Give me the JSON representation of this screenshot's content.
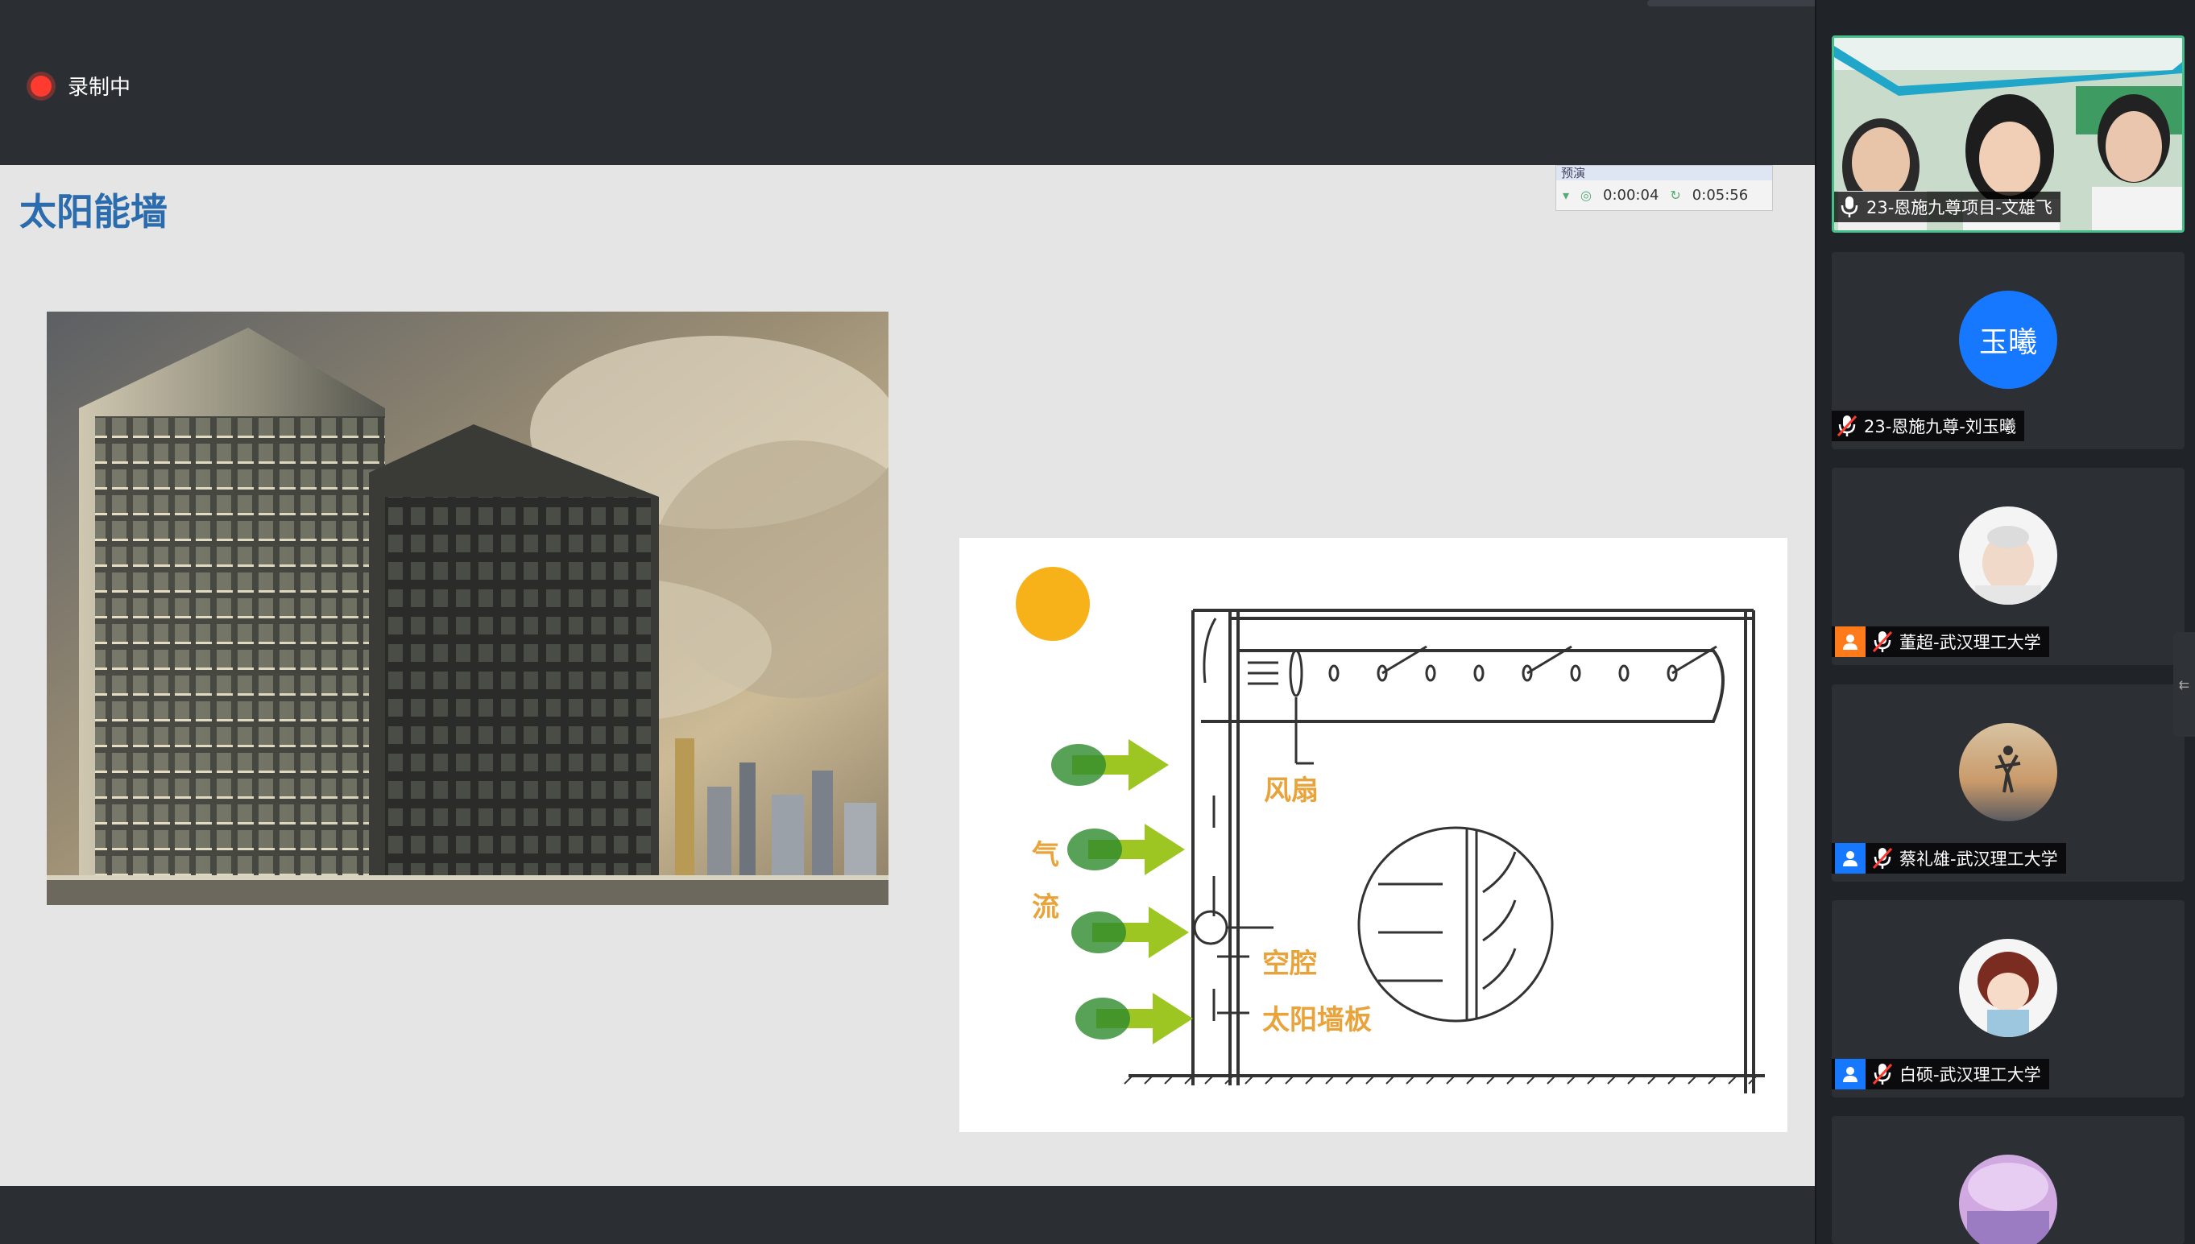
{
  "meeting": {
    "recording_label": "录制中"
  },
  "slide": {
    "title": "太阳能墙",
    "player": {
      "header": "预演",
      "elapsed": "0:00:04",
      "total": "0:05:56"
    },
    "diagram": {
      "label_fan": "风扇",
      "label_airflow_1": "气",
      "label_airflow_2": "流",
      "label_cavity": "空腔",
      "label_panel": "太阳墙板"
    }
  },
  "participants": [
    {
      "name": "23-恩施九尊项目-文雄飞",
      "mic": "on",
      "role": "none",
      "type": "video"
    },
    {
      "name": "23-恩施九尊-刘玉曦",
      "mic": "muted",
      "role": "none",
      "type": "text-avatar",
      "avatar_text": "玉曦",
      "avatar_color": "#1677ff"
    },
    {
      "name": "董超-武汉理工大学",
      "mic": "muted",
      "role": "host",
      "type": "image-avatar",
      "role_color": "#ff7a1a"
    },
    {
      "name": "蔡礼雄-武汉理工大学",
      "mic": "muted",
      "role": "cohost",
      "type": "image-avatar",
      "role_color": "#1677ff"
    },
    {
      "name": "白硕-武汉理工大学",
      "mic": "muted",
      "role": "cohost",
      "type": "image-avatar",
      "role_color": "#1677ff"
    },
    {
      "type": "image-avatar"
    }
  ],
  "colors": {
    "accent_title": "#2a6cad",
    "record": "#ff3b30",
    "active_speaker": "#46c08a",
    "diagram_label": "#e8a33a"
  }
}
